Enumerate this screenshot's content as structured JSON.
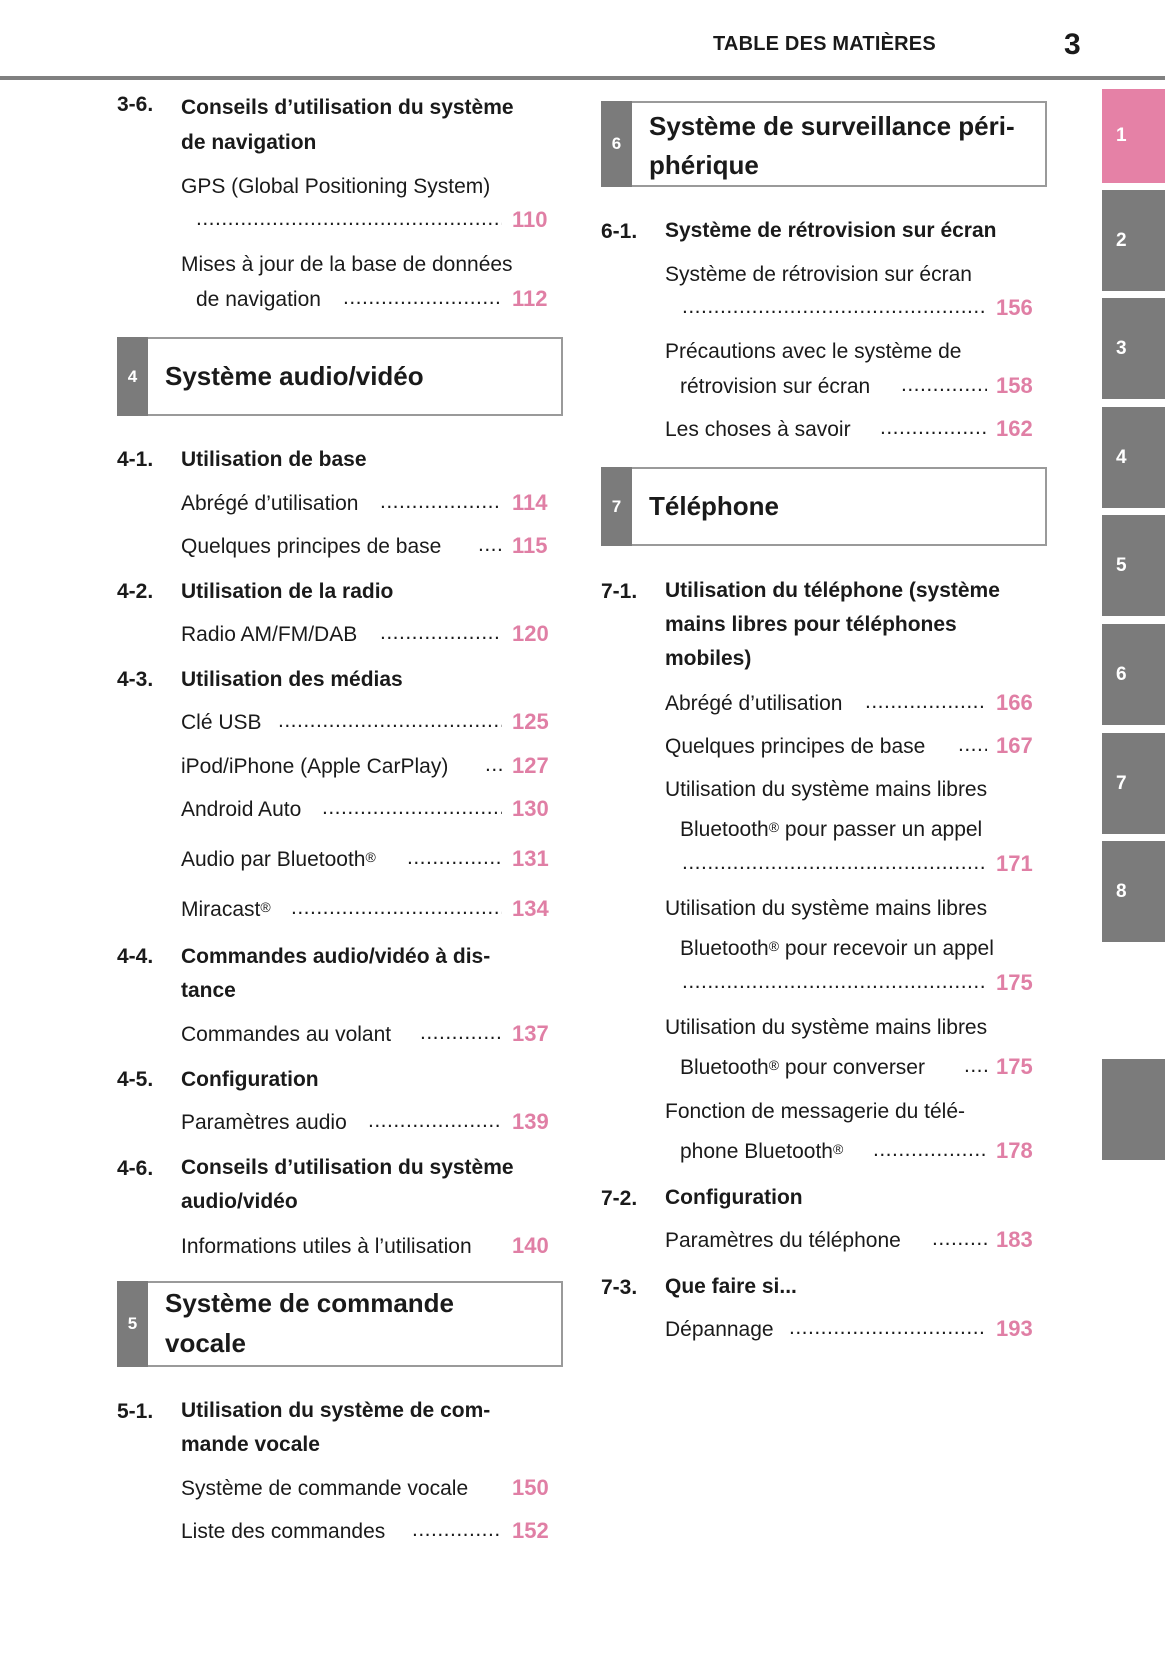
{
  "header": {
    "title": "TABLE DES MATIÈRES",
    "page_number": "3"
  },
  "accent_color": "#e581a6",
  "tabs": [
    {
      "label": "1",
      "active": true
    },
    {
      "label": "2"
    },
    {
      "label": "3"
    },
    {
      "label": "4"
    },
    {
      "label": "5"
    },
    {
      "label": "6"
    },
    {
      "label": "7"
    },
    {
      "label": "8"
    },
    {
      "label": ""
    }
  ],
  "left": {
    "s36": {
      "num": "3-6.",
      "title_l1": "Conseils d’utilisation du système",
      "title_l2": "de navigation",
      "e1_l1": "GPS (Global Positioning System)",
      "e1_page": "110",
      "e2_l1": "Mises à jour de la base de données",
      "e2_l2": "de navigation",
      "e2_page": "112"
    },
    "ch4": {
      "num": "4",
      "title": "Système audio/vidéo"
    },
    "s41": {
      "num": "4-1.",
      "title": "Utilisation de base",
      "e1": "Abrégé d’utilisation",
      "e1_page": "114",
      "e2": "Quelques principes de base",
      "e2_page": "115"
    },
    "s42": {
      "num": "4-2.",
      "title": "Utilisation de la radio",
      "e1": "Radio AM/FM/DAB",
      "e1_page": "120"
    },
    "s43": {
      "num": "4-3.",
      "title": "Utilisation des médias",
      "e1": "Clé USB",
      "e1_page": "125",
      "e2": "iPod/iPhone (Apple CarPlay)",
      "e2_page": "127",
      "e3": "Android Auto",
      "e3_page": "130",
      "e4": "Audio par Bluetooth",
      "e4_page": "131",
      "e5": "Miracast",
      "e5_page": "134",
      "reg": "®"
    },
    "s44": {
      "num": "4-4.",
      "title_l1": "Commandes audio/vidéo à dis-",
      "title_l2": "tance",
      "e1": "Commandes au volant",
      "e1_page": "137"
    },
    "s45": {
      "num": "4-5.",
      "title": "Configuration",
      "e1": "Paramètres audio",
      "e1_page": "139"
    },
    "s46": {
      "num": "4-6.",
      "title_l1": "Conseils d’utilisation du système",
      "title_l2": "audio/vidéo",
      "e1": "Informations utiles à l’utilisation",
      "e1_page": "140"
    },
    "ch5": {
      "num": "5",
      "title_l1": "Système de commande",
      "title_l2": "vocale"
    },
    "s51": {
      "num": "5-1.",
      "title_l1": "Utilisation du système de com-",
      "title_l2": "mande vocale",
      "e1": "Système de commande vocale",
      "e1_page": "150",
      "e2": "Liste des commandes",
      "e2_page": "152"
    }
  },
  "right": {
    "ch6": {
      "num": "6",
      "title_l1": "Système de surveillance péri-",
      "title_l2": "phérique"
    },
    "s61": {
      "num": "6-1.",
      "title": "Système de rétrovision sur écran",
      "e1_l1": "Système de rétrovision sur écran",
      "e1_page": "156",
      "e2_l1": "Précautions avec le système de",
      "e2_l2": "rétrovision sur écran",
      "e2_page": "158",
      "e3": "Les choses à savoir",
      "e3_page": "162"
    },
    "ch7": {
      "num": "7",
      "title": "Téléphone"
    },
    "s71": {
      "num": "7-1.",
      "title_l1": "Utilisation du téléphone (système",
      "title_l2": "mains libres pour téléphones",
      "title_l3": "mobiles)",
      "e1": "Abrégé d’utilisation",
      "e1_page": "166",
      "e2": "Quelques principes de base",
      "e2_page": "167",
      "e3_l1": "Utilisation du système mains libres",
      "e3_l2a": "Bluetooth",
      "e3_l2b": " pour passer un appel",
      "e3_page": "171",
      "e4_l1": "Utilisation du système mains libres",
      "e4_l2a": "Bluetooth",
      "e4_l2b": " pour recevoir un appel",
      "e4_page": "175",
      "e5_l1": "Utilisation du système mains libres",
      "e5_l2a": "Bluetooth",
      "e5_l2b": " pour converser",
      "e5_page": "175",
      "e6_l1": "Fonction de messagerie du télé-",
      "e6_l2a": "phone Bluetooth",
      "e6_page": "178",
      "reg": "®"
    },
    "s72": {
      "num": "7-2.",
      "title": "Configuration",
      "e1": "Paramètres du téléphone",
      "e1_page": "183"
    },
    "s73": {
      "num": "7-3.",
      "title": "Que faire si...",
      "e1": "Dépannage",
      "e1_page": "193"
    }
  }
}
